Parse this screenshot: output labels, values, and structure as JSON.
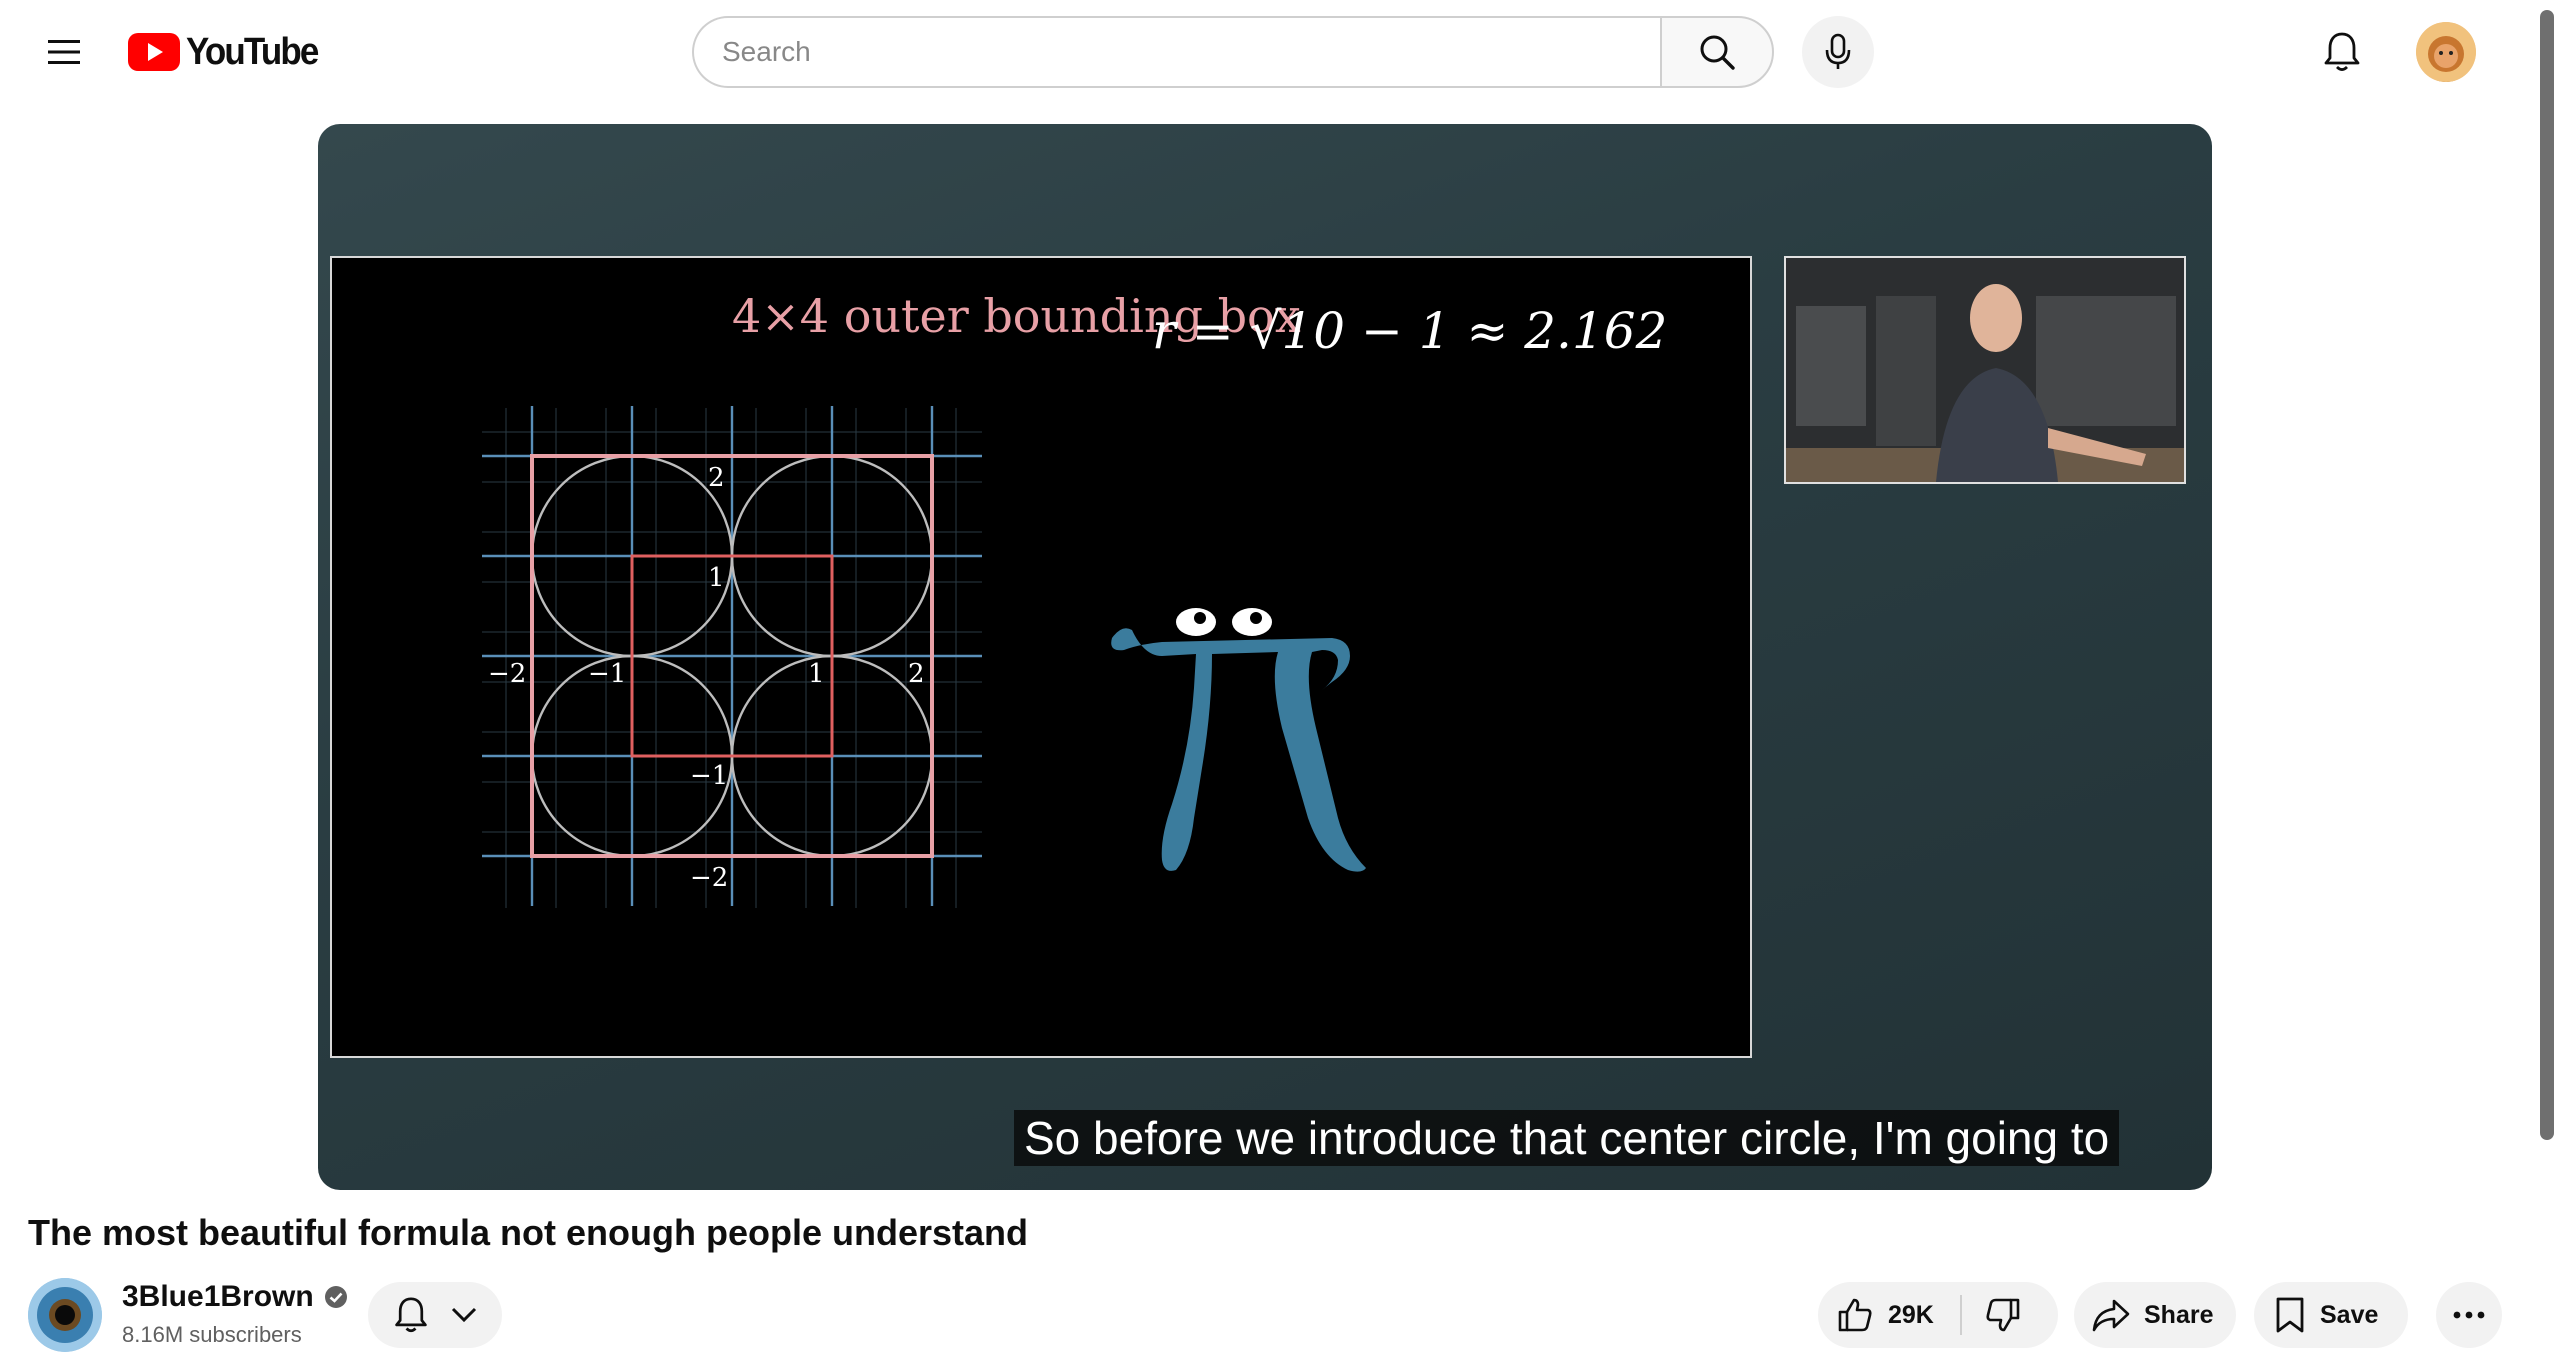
{
  "masthead": {
    "logo_text": "YouTube",
    "search_placeholder": "Search"
  },
  "player": {
    "slide": {
      "heading": "4×4 outer bounding box",
      "formula": "r = √10 − 1 ≈ 2.162",
      "tick_labels": {
        "x_pos_1": "1",
        "x_pos_2": "2",
        "x_neg_1": "−1",
        "x_neg_2": "−2",
        "y_pos_1": "1",
        "y_pos_2": "2",
        "y_neg_1": "−1",
        "y_neg_2": "−2"
      }
    },
    "caption": "So before we introduce that center circle, I'm going to"
  },
  "video": {
    "title": "The most beautiful formula not enough people understand"
  },
  "channel": {
    "name": "3Blue1Brown",
    "subscribers": "8.16M subscribers"
  },
  "actions": {
    "like_count": "29K",
    "share_label": "Share",
    "save_label": "Save"
  },
  "colors": {
    "brand_red": "#ff0000",
    "pi_blue": "#3b7c9d",
    "slide_pink": "#e8a0a6",
    "grid_blue": "#5a8fb8"
  }
}
